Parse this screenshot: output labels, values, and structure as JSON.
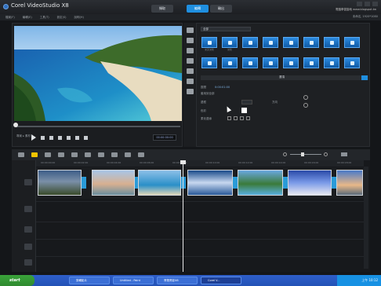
{
  "app": {
    "title": "Corel VideoStudio X8"
  },
  "steps": [
    {
      "label": "擷取"
    },
    {
      "label": "編輯"
    },
    {
      "label": "輸出"
    }
  ],
  "brand": "電腦學習園地 www.blogspot.tw",
  "menu": [
    "檔案(F)",
    "編輯(E)",
    "工具(T)",
    "設定(S)",
    "說明(H)"
  ],
  "ucc": "未命名, 1920*1080",
  "player": {
    "mode_project": "專案",
    "mode_clip": "素材",
    "timecode": "00:00:00:00"
  },
  "library": {
    "dropdown": "全部",
    "thumb_labels": [
      "交叉淡化",
      "淡化",
      "",
      "",
      "",
      "",
      "",
      "",
      "",
      "",
      "",
      "",
      "",
      "",
      "",
      ""
    ]
  },
  "options": {
    "title": "選項",
    "label1": "區間",
    "label2": "邊框",
    "label3": "色彩",
    "label4": "柔化邊緣",
    "label5": "方向",
    "checkbox1": "套用到全部",
    "duration": "0:00:01:00"
  },
  "timeline": {
    "ruler": [
      "00:00:00:00",
      "00:00:02:00",
      "00:00:04:00",
      "00:00:06:00",
      "00:00:08:00",
      "00:00:10:00",
      "00:00:12:00",
      "00:00:14:00",
      "00:00:16:00",
      "00:00:18:00"
    ]
  },
  "taskbar": {
    "start": "start",
    "tasks": [
      "剪輯影片",
      "Untitled - Paint",
      "會聲會影X8",
      "Corel V..."
    ],
    "clock": "上午 10:12"
  }
}
